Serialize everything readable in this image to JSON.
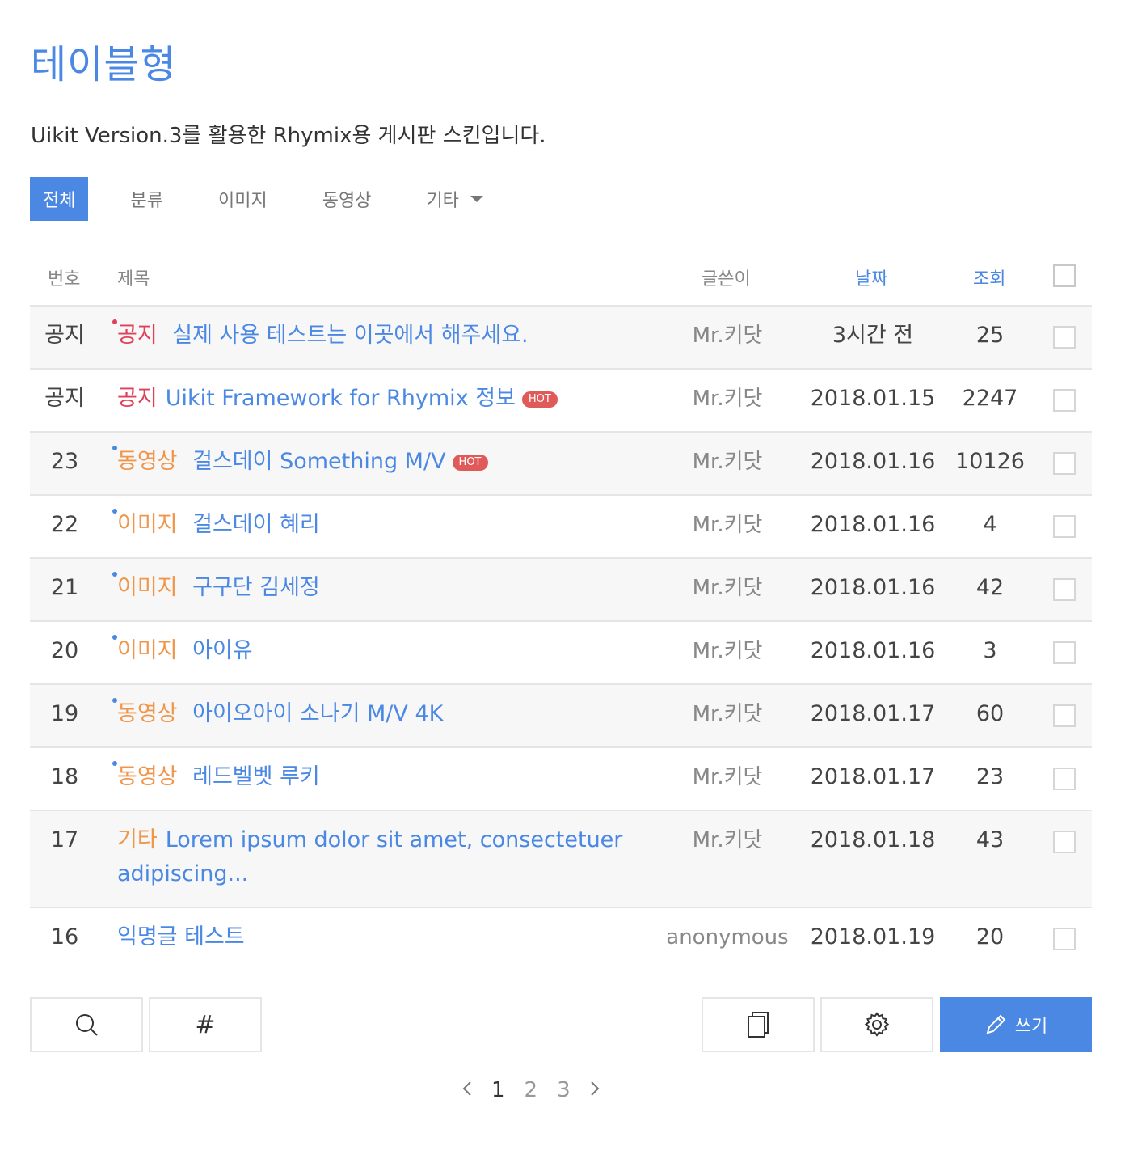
{
  "header": {
    "title": "테이블형",
    "subtitle": "Uikit Version.3를 활용한 Rhymix용 게시판 스킨입니다."
  },
  "categories": {
    "all": "전체",
    "items": [
      "분류",
      "이미지",
      "동영상"
    ],
    "more_label": "기타"
  },
  "table": {
    "headers": {
      "no": "번호",
      "title": "제목",
      "author": "글쓴이",
      "date": "날짜",
      "views": "조회"
    },
    "rows": [
      {
        "no": "공지",
        "category": "공지",
        "title": "실제 사용 테스트는 이곳에서 해주세요.",
        "hot": "",
        "author": "Mr.키닷",
        "date": "3시간 전",
        "views": "25"
      },
      {
        "no": "공지",
        "category": "공지",
        "title": "Uikit Framework for Rhymix 정보",
        "hot": "HOT",
        "author": "Mr.키닷",
        "date": "2018.01.15",
        "views": "2247"
      },
      {
        "no": "23",
        "category": "동영상",
        "title": "걸스데이 Something M/V",
        "hot": "HOT",
        "author": "Mr.키닷",
        "date": "2018.01.16",
        "views": "10126"
      },
      {
        "no": "22",
        "category": "이미지",
        "title": "걸스데이 혜리",
        "hot": "",
        "author": "Mr.키닷",
        "date": "2018.01.16",
        "views": "4"
      },
      {
        "no": "21",
        "category": "이미지",
        "title": "구구단 김세정",
        "hot": "",
        "author": "Mr.키닷",
        "date": "2018.01.16",
        "views": "42"
      },
      {
        "no": "20",
        "category": "이미지",
        "title": "아이유",
        "hot": "",
        "author": "Mr.키닷",
        "date": "2018.01.16",
        "views": "3"
      },
      {
        "no": "19",
        "category": "동영상",
        "title": "아이오아이 소나기 M/V 4K",
        "hot": "",
        "author": "Mr.키닷",
        "date": "2018.01.17",
        "views": "60"
      },
      {
        "no": "18",
        "category": "동영상",
        "title": "레드벨벳 루키",
        "hot": "",
        "author": "Mr.키닷",
        "date": "2018.01.17",
        "views": "23"
      },
      {
        "no": "17",
        "category": "기타",
        "title": "Lorem ipsum dolor sit amet, consectetuer",
        "title_line2": "adipiscing...",
        "hot": "",
        "author": "Mr.키닷",
        "date": "2018.01.18",
        "views": "43"
      },
      {
        "no": "16",
        "category": "",
        "title": "익명글 테스트",
        "hot": "",
        "author": "anonymous",
        "date": "2018.01.19",
        "views": "20"
      }
    ]
  },
  "buttons": {
    "tag_symbol": "#",
    "write_label": "쓰기",
    "search_icon": "search-icon",
    "copy_icon": "copy-icon",
    "admin_icon": "gear-icon",
    "write_icon": "pencil-icon"
  },
  "pagination": {
    "pages": [
      "1",
      "2",
      "3"
    ],
    "current": "1"
  },
  "colors": {
    "accent": "#4a88e4",
    "notice": "#e0405a",
    "category": "#f0964b",
    "hot_badge": "#e05a5a"
  }
}
